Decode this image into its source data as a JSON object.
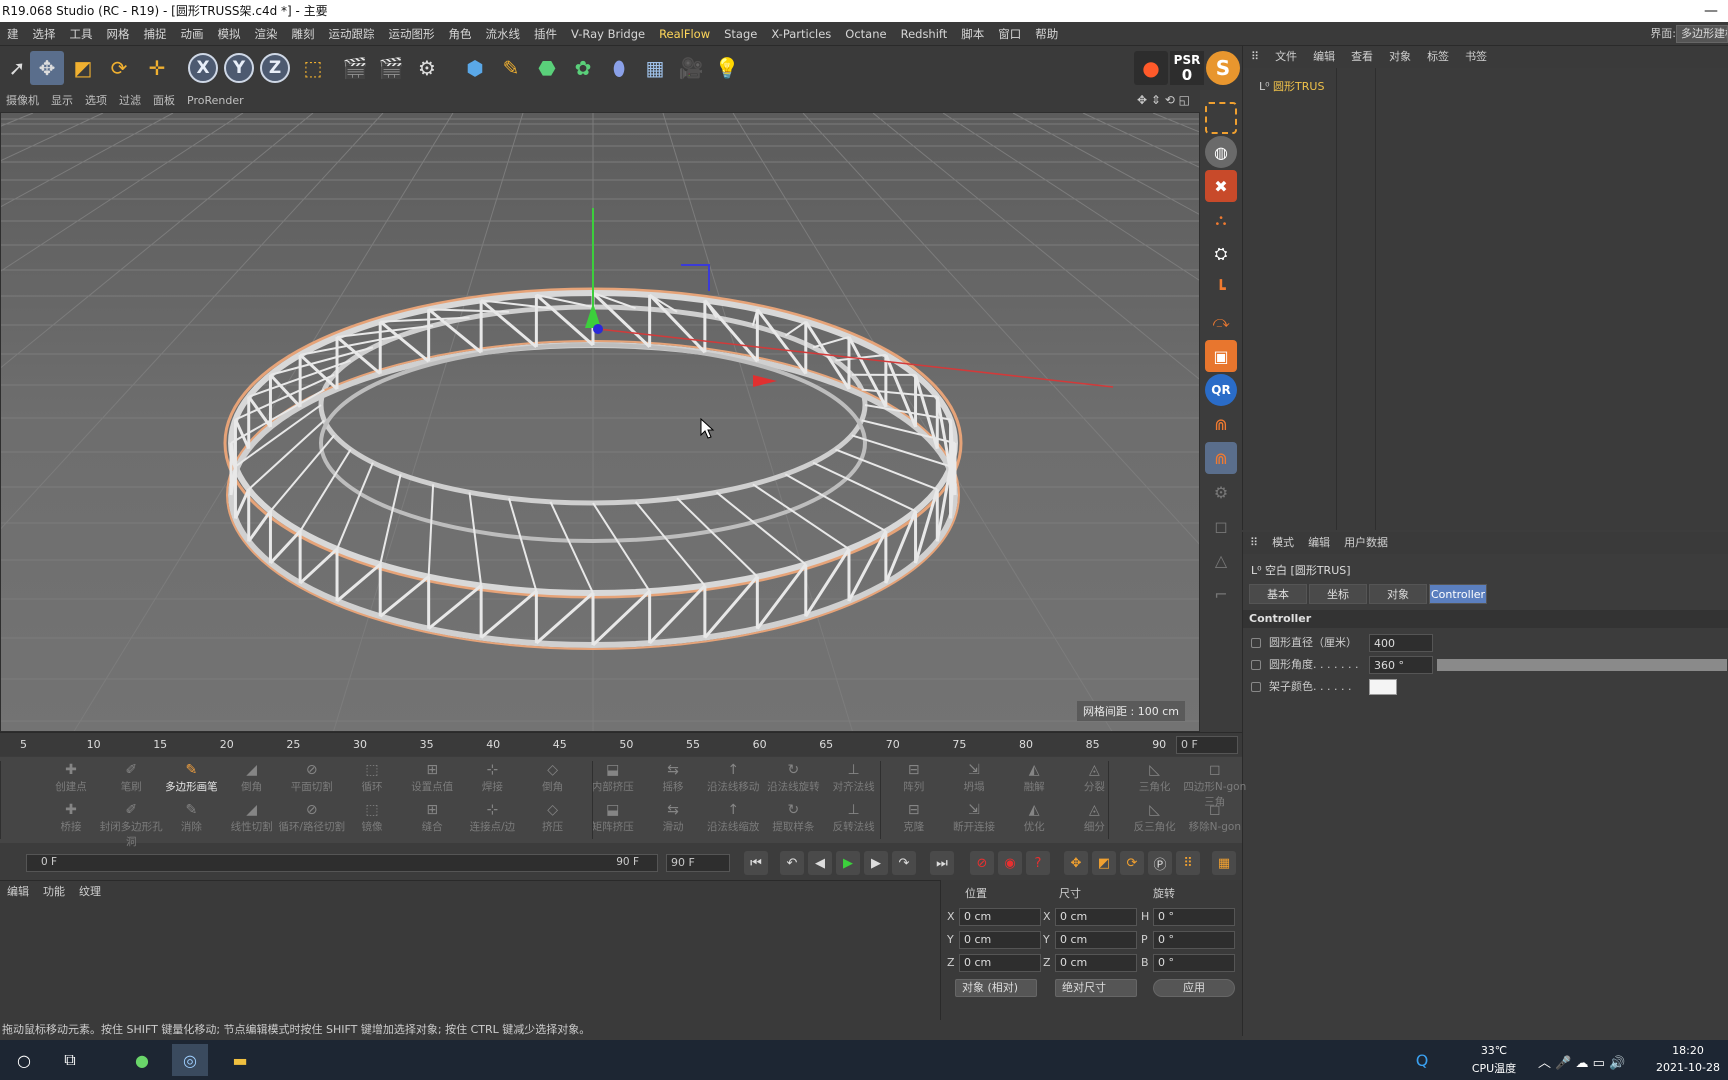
{
  "window": {
    "title": "R19.068 Studio (RC - R19) - [圆形TRUSS架.c4d *] - 主要",
    "min_icon": "—"
  },
  "menubar": {
    "items": [
      "建",
      "选择",
      "工具",
      "网格",
      "捕捉",
      "动画",
      "模拟",
      "渲染",
      "雕刻",
      "运动跟踪",
      "运动图形",
      "角色",
      "流水线",
      "插件",
      "V-Ray Bridge",
      "RealFlow",
      "Stage",
      "X-Particles",
      "Octane",
      "Redshift",
      "脚本",
      "窗口",
      "帮助"
    ],
    "highlight": "RealFlow",
    "layout_label": "界面:",
    "layout_value": "多边形建模"
  },
  "viewport": {
    "menu": [
      "摄像机",
      "显示",
      "选项",
      "过滤",
      "面板",
      "ProRender"
    ],
    "grid_spacing": "网格间距 : 100 cm"
  },
  "object_manager": {
    "menu": [
      "文件",
      "编辑",
      "查看",
      "对象",
      "标签",
      "书签"
    ],
    "object_name": "圆形TRUS"
  },
  "attribute_manager": {
    "menu": [
      "模式",
      "编辑",
      "用户数据"
    ],
    "object_title": "空白 [圆形TRUS]",
    "tabs": [
      "基本",
      "坐标",
      "对象",
      "Controller"
    ],
    "active_tab": "Controller",
    "section": "Controller",
    "fields": [
      {
        "label": "圆形直径（厘米）",
        "value": "400"
      },
      {
        "label": "圆形角度. . . . . . .",
        "value": "360 °",
        "fill": 1.0
      },
      {
        "label": "架子颜色. . . . . .",
        "color": "#f4f4f4"
      }
    ]
  },
  "timeline": {
    "ruler_ticks": [
      "5",
      "10",
      "15",
      "20",
      "25",
      "30",
      "35",
      "40",
      "45",
      "50",
      "55",
      "60",
      "65",
      "70",
      "75",
      "80",
      "85",
      "90"
    ],
    "current_frame": "0 F",
    "slider_start": "0 F",
    "slider_end": "90 F",
    "end_frame": "90 F"
  },
  "tools": {
    "row1": [
      "创建点",
      "笔刷",
      "多边形画笔",
      "倒角",
      "平面切割",
      "循环",
      "设置点值",
      "焊接",
      "倒角",
      "内部挤压",
      "摇移",
      "沿法线移动",
      "沿法线旋转",
      "对齐法线",
      "阵列",
      "坍塌",
      "融解",
      "分裂",
      "三角化",
      "四边形N-gon三角"
    ],
    "row2": [
      "桥接",
      "封闭多边形孔洞",
      "消除",
      "线性切割",
      "循环/路径切割",
      "镜像",
      "缝合",
      "连接点/边",
      "挤压",
      "矩阵挤压",
      "滑动",
      "沿法线缩放",
      "提取样条",
      "反转法线",
      "克隆",
      "断开连接",
      "优化",
      "细分",
      "反三角化",
      "移除N-gon"
    ],
    "active": "多边形画笔"
  },
  "material_manager": {
    "menu": [
      "编辑",
      "功能",
      "纹理"
    ]
  },
  "coordinates": {
    "headers": [
      "位置",
      "尺寸",
      "旋转"
    ],
    "position": {
      "X": "0 cm",
      "Y": "0 cm",
      "Z": "0 cm"
    },
    "size": {
      "X": "0 cm",
      "Y": "0 cm",
      "Z": "0 cm"
    },
    "rotation": {
      "H": "0 °",
      "P": "0 °",
      "B": "0 °"
    },
    "mode_dropdown": "对象 (相对)",
    "size_dropdown": "绝对尺寸",
    "apply_button": "应用"
  },
  "statusbar": {
    "text": "拖动鼠标移动元素。按住 SHIFT 键量化移动; 节点编辑模式时按住 SHIFT 键增加选择对象; 按住 CTRL 键减少选择对象。"
  },
  "taskbar": {
    "temperature": "33℃",
    "temp_label": "CPU温度",
    "time": "18:20",
    "date": "2021-10-28"
  },
  "toolbar": {
    "psr_label": "PSR",
    "psr_value": "0",
    "axis_x": "X",
    "axis_y": "Y",
    "axis_z": "Z"
  },
  "colors": {
    "accent": "#5b7fbf",
    "highlight": "#ffd75a",
    "object_name": "#f0c24a"
  }
}
